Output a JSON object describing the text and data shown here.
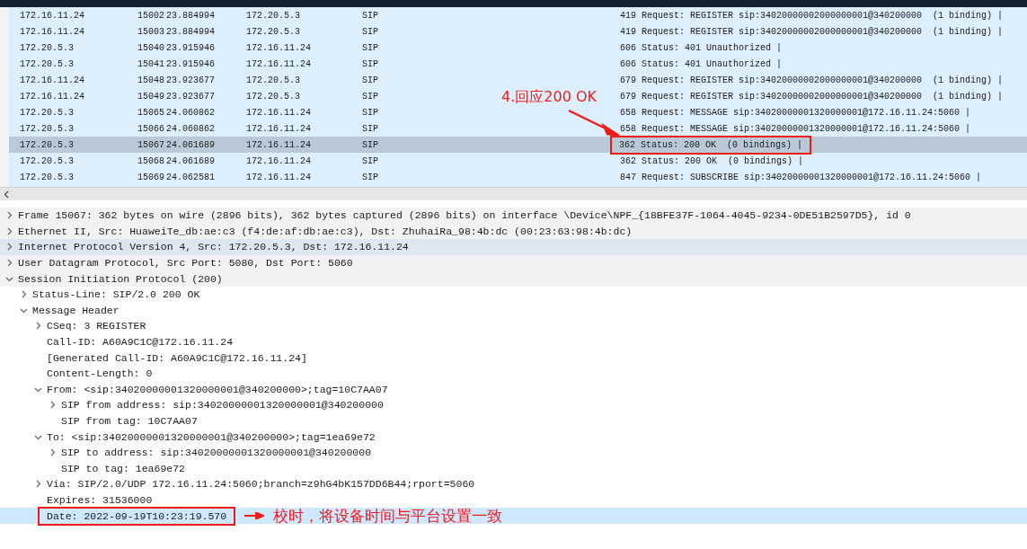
{
  "packet_list": {
    "rows": [
      {
        "source": "172.16.11.24",
        "no": "15002",
        "time": "23.884994",
        "destination": "172.20.5.3",
        "protocol": "SIP",
        "info": "419 Request: REGISTER sip:34020000002000000001@340200000  (1 binding) |",
        "selected": false,
        "boxed": false
      },
      {
        "source": "172.16.11.24",
        "no": "15003",
        "time": "23.884994",
        "destination": "172.20.5.3",
        "protocol": "SIP",
        "info": "419 Request: REGISTER sip:34020000002000000001@340200000  (1 binding) |",
        "selected": false,
        "boxed": false
      },
      {
        "source": "172.20.5.3",
        "no": "15040",
        "time": "23.915946",
        "destination": "172.16.11.24",
        "protocol": "SIP",
        "info": "606 Status: 401 Unauthorized |",
        "selected": false,
        "boxed": false
      },
      {
        "source": "172.20.5.3",
        "no": "15041",
        "time": "23.915946",
        "destination": "172.16.11.24",
        "protocol": "SIP",
        "info": "606 Status: 401 Unauthorized |",
        "selected": false,
        "boxed": false
      },
      {
        "source": "172.16.11.24",
        "no": "15048",
        "time": "23.923677",
        "destination": "172.20.5.3",
        "protocol": "SIP",
        "info": "679 Request: REGISTER sip:34020000002000000001@340200000  (1 binding) |",
        "selected": false,
        "boxed": false
      },
      {
        "source": "172.16.11.24",
        "no": "15049",
        "time": "23.923677",
        "destination": "172.20.5.3",
        "protocol": "SIP",
        "info": "679 Request: REGISTER sip:34020000002000000001@340200000  (1 binding) |",
        "selected": false,
        "boxed": false
      },
      {
        "source": "172.20.5.3",
        "no": "15065",
        "time": "24.060862",
        "destination": "172.16.11.24",
        "protocol": "SIP",
        "info": "658 Request: MESSAGE sip:34020000001320000001@172.16.11.24:5060 |",
        "selected": false,
        "boxed": false
      },
      {
        "source": "172.20.5.3",
        "no": "15066",
        "time": "24.060862",
        "destination": "172.16.11.24",
        "protocol": "SIP",
        "info": "658 Request: MESSAGE sip:34020000001320000001@172.16.11.24:5060 |",
        "selected": false,
        "boxed": false
      },
      {
        "source": "172.20.5.3",
        "no": "15067",
        "time": "24.061689",
        "destination": "172.16.11.24",
        "protocol": "SIP",
        "info": "362 Status: 200 OK  (0 bindings) |",
        "selected": true,
        "boxed": true,
        "note": "4.回应200 OK"
      },
      {
        "source": "172.20.5.3",
        "no": "15068",
        "time": "24.061689",
        "destination": "172.16.11.24",
        "protocol": "SIP",
        "info": "362 Status: 200 OK  (0 bindings) |",
        "selected": false,
        "boxed": false
      },
      {
        "source": "172.20.5.3",
        "no": "15069",
        "time": "24.062581",
        "destination": "172.16.11.24",
        "protocol": "SIP",
        "info": "847 Request: SUBSCRIBE sip:34020000001320000001@172.16.11.24:5060 |",
        "selected": false,
        "boxed": false
      }
    ]
  },
  "details": [
    {
      "text": "Frame 15067: 362 bytes on wire (2896 bits), 362 bytes captured (2896 bits) on interface \\Device\\NPF_{18BFE37F-1064-4045-9234-0DE51B2597D5}, id 0",
      "expanded": false,
      "hovered": false
    },
    {
      "text": "Ethernet II, Src: HuaweiTe_db:ae:c3 (f4:de:af:db:ae:c3), Dst: ZhuhaiRa_98:4b:dc (00:23:63:98:4b:dc)",
      "expanded": false,
      "hovered": false
    },
    {
      "text": "Internet Protocol Version 4, Src: 172.20.5.3, Dst: 172.16.11.24",
      "expanded": false,
      "hovered": true
    },
    {
      "text": "User Datagram Protocol, Src Port: 5080, Dst Port: 5060",
      "expanded": false,
      "hovered": false
    },
    {
      "text": "Session Initiation Protocol (200)",
      "expanded": true,
      "hovered": false,
      "children": [
        {
          "text": "Status-Line: SIP/2.0 200 OK",
          "kind": "branch",
          "expanded": false,
          "selected": false
        },
        {
          "text": "Message Header",
          "kind": "branch",
          "expanded": true,
          "selected": false,
          "children": [
            {
              "text": "CSeq: 3 REGISTER",
              "kind": "branch",
              "expanded": false,
              "selected": false
            },
            {
              "text": "Call-ID: A60A9C1C@172.16.11.24",
              "kind": "leaf",
              "selected": false
            },
            {
              "text": "[Generated Call-ID: A60A9C1C@172.16.11.24]",
              "kind": "leaf",
              "selected": false
            },
            {
              "text": "Content-Length: 0",
              "kind": "leaf",
              "selected": false
            },
            {
              "text": "From: <sip:34020000001320000001@340200000>;tag=10C7AA07",
              "kind": "branch",
              "expanded": true,
              "selected": false,
              "children": [
                {
                  "text": "SIP from address: sip:34020000001320000001@340200000",
                  "kind": "branch",
                  "expanded": false,
                  "selected": false
                },
                {
                  "text": "SIP from tag: 10C7AA07",
                  "kind": "leaf",
                  "selected": false
                }
              ]
            },
            {
              "text": "To: <sip:34020000001320000001@340200000>;tag=1ea69e72",
              "kind": "branch",
              "expanded": true,
              "selected": false,
              "children": [
                {
                  "text": "SIP to address: sip:34020000001320000001@340200000",
                  "kind": "branch",
                  "expanded": false,
                  "selected": false
                },
                {
                  "text": "SIP to tag: 1ea69e72",
                  "kind": "leaf",
                  "selected": false
                }
              ]
            },
            {
              "text": "Via: SIP/2.0/UDP 172.16.11.24:5060;branch=z9hG4bK157DD6B44;rport=5060",
              "kind": "branch",
              "expanded": false,
              "selected": false
            },
            {
              "text": "Expires: 31536000",
              "kind": "leaf",
              "selected": false
            },
            {
              "text": "Date: 2022-09-19T10:23:19.570",
              "kind": "leaf",
              "selected": true,
              "boxed": true,
              "note": "校时，将设备时间与平台设置一致"
            }
          ]
        }
      ]
    }
  ]
}
